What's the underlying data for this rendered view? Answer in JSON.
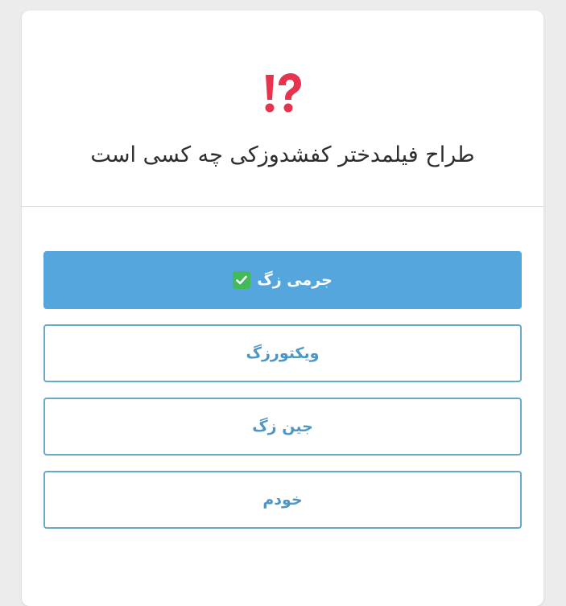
{
  "quiz": {
    "icon": "exclamation-question-mark-icon",
    "question": "طراح فیلمدختر کفشدوزکی چه کسی است",
    "options": [
      {
        "label": "جرمی زگ",
        "selected": true,
        "mark_icon": "check-mark-icon"
      },
      {
        "label": "ویکتورزگ",
        "selected": false
      },
      {
        "label": "جین زگ",
        "selected": false
      },
      {
        "label": "خودم",
        "selected": false
      }
    ]
  },
  "colors": {
    "selected_bg": "#55a6dd",
    "option_border": "#6aa9c6",
    "option_text": "#4f97c2",
    "check_green": "#43b95a",
    "icon_red": "#e8334f"
  }
}
